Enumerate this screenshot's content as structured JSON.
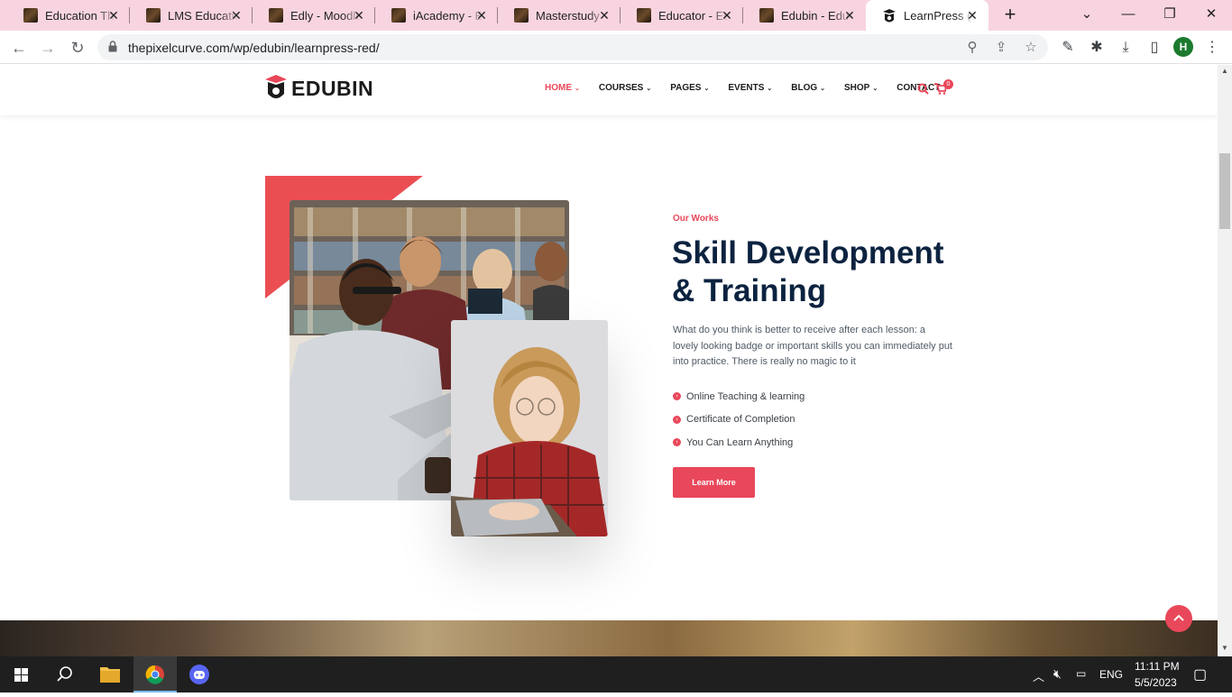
{
  "browser": {
    "tabs": [
      {
        "title": "Education The",
        "active": false
      },
      {
        "title": "LMS Educatic",
        "active": false
      },
      {
        "title": "Edly - Moodle",
        "active": false
      },
      {
        "title": "iAcademy - Ec",
        "active": false
      },
      {
        "title": "Masterstudy",
        "active": false
      },
      {
        "title": "Educator - Ed",
        "active": false
      },
      {
        "title": "Edubin - Educ",
        "active": false
      },
      {
        "title": "LearnPress (R",
        "active": true
      }
    ],
    "url": "thepixelcurve.com/wp/edubin/learnpress-red/",
    "profile_initial": "H"
  },
  "site": {
    "logo_text": "EDUBIN",
    "menu": [
      {
        "label": "HOME",
        "active": true,
        "dropdown": true
      },
      {
        "label": "COURSES",
        "active": false,
        "dropdown": true
      },
      {
        "label": "PAGES",
        "active": false,
        "dropdown": true
      },
      {
        "label": "EVENTS",
        "active": false,
        "dropdown": true
      },
      {
        "label": "BLOG",
        "active": false,
        "dropdown": true
      },
      {
        "label": "SHOP",
        "active": false,
        "dropdown": true
      },
      {
        "label": "CONTACT",
        "active": false,
        "dropdown": false
      }
    ],
    "cart_count": "0",
    "accent": "#e9475a"
  },
  "hero": {
    "eyebrow": "Our Works",
    "title_line1": "Skill Development",
    "title_line2": "& Training",
    "paragraph": "What do you think is better to receive after each lesson: a lovely looking badge or important skills you can immediately put into practice. There is really no magic to it",
    "features": [
      "Online Teaching & learning",
      "Certificate of Completion",
      "You Can Learn Anything"
    ],
    "button": "Learn More"
  },
  "taskbar": {
    "language": "ENG",
    "time": "11:11 PM",
    "date": "5/5/2023"
  }
}
